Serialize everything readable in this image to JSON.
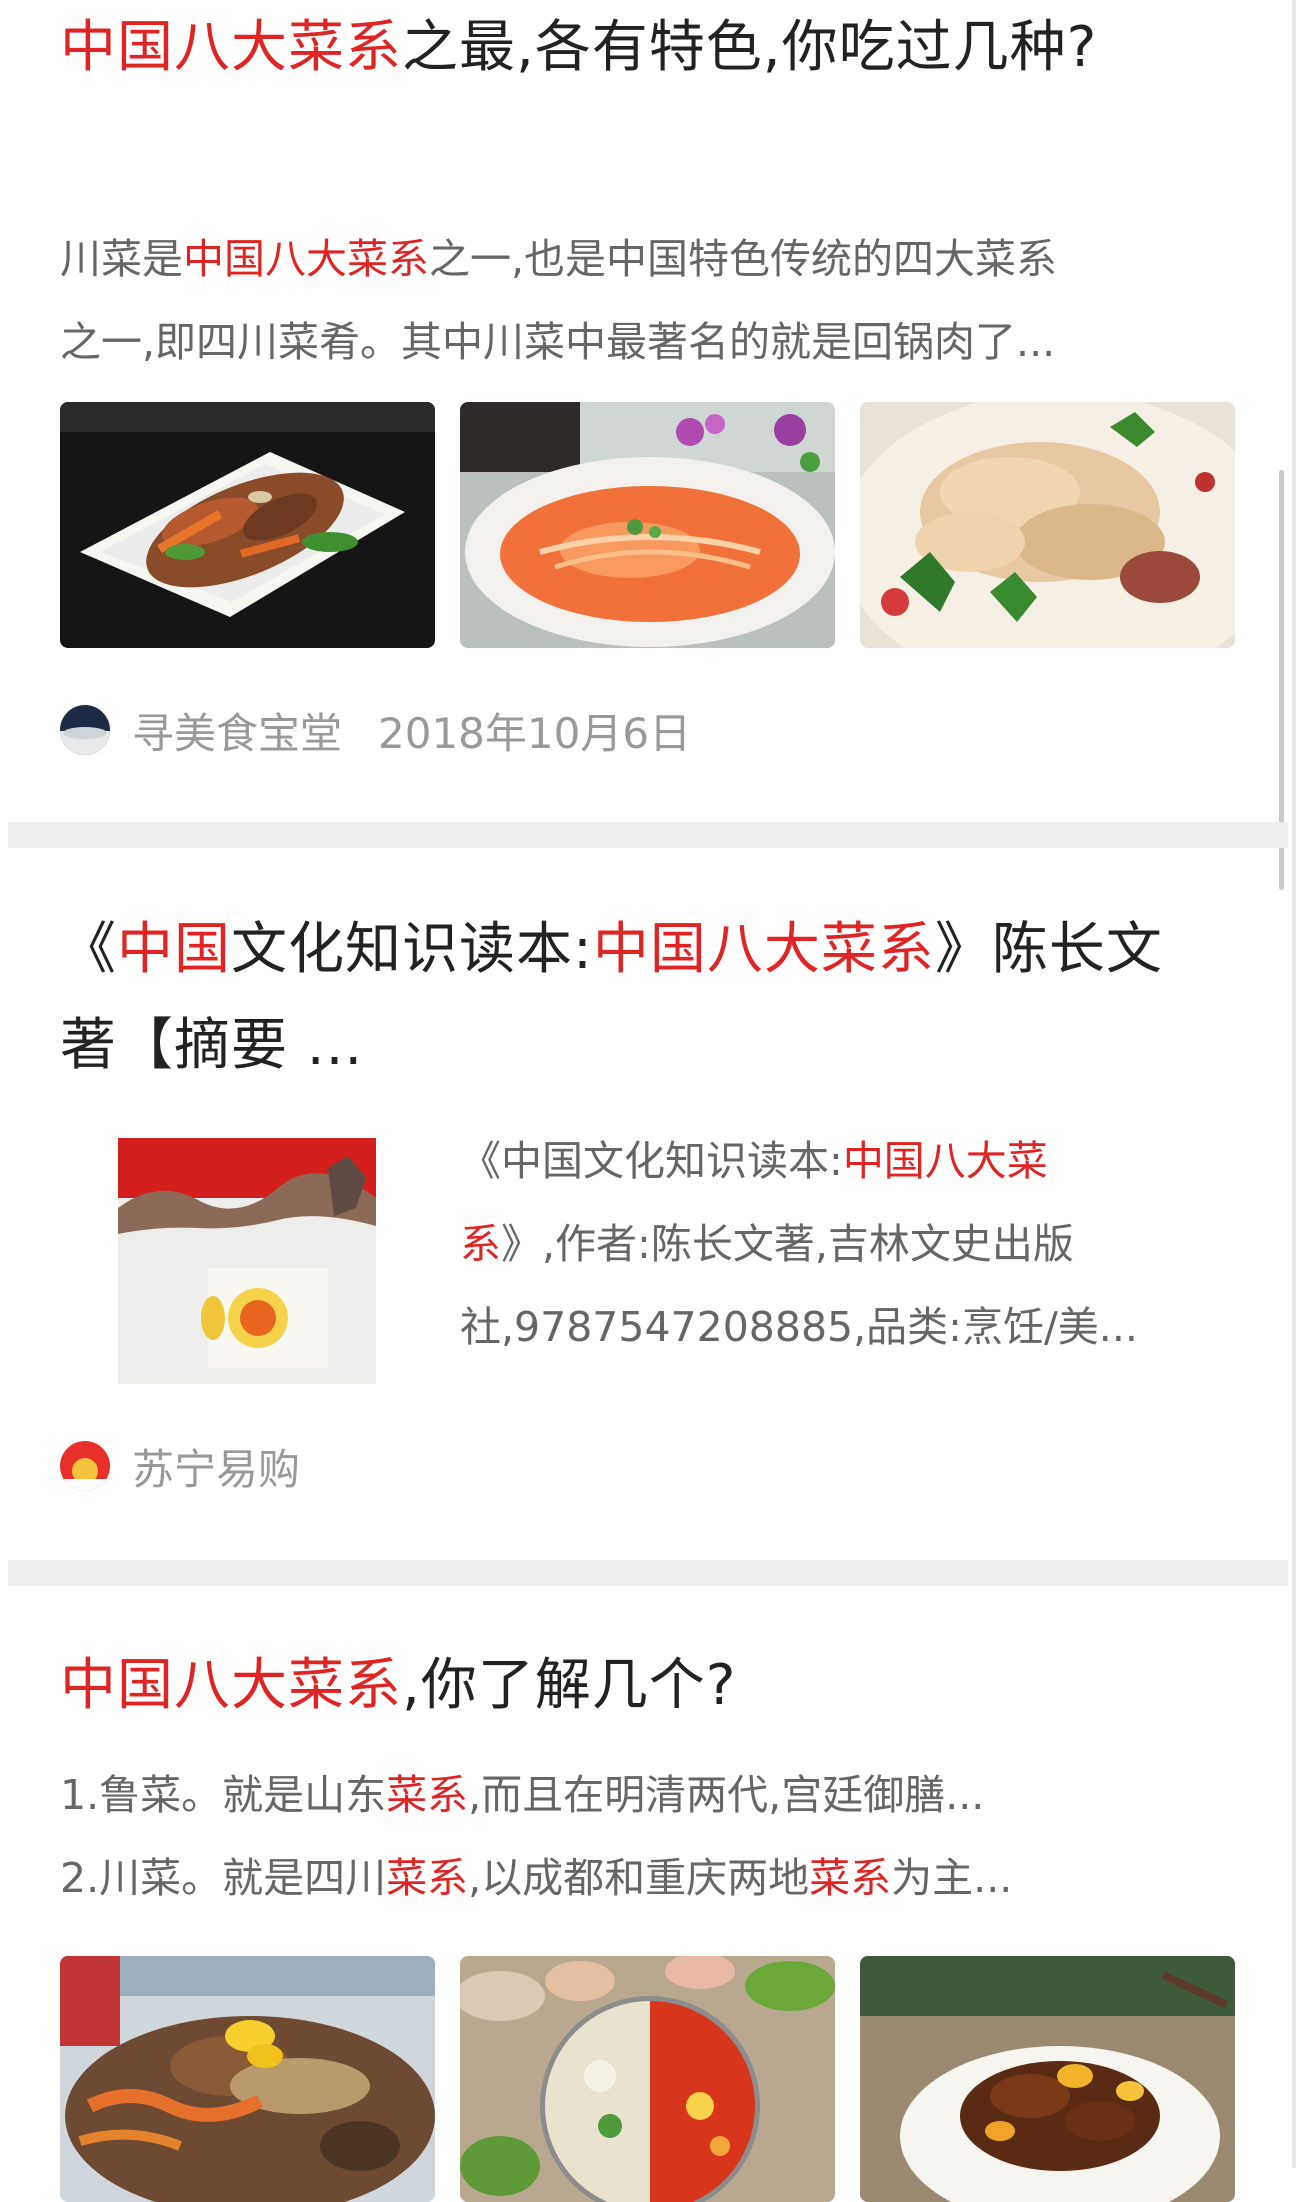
{
  "results": [
    {
      "title": {
        "hl1": "中国八大菜系",
        "rest": "之最,各有特色,你吃过几种?"
      },
      "abstract": {
        "line1_a": "川菜是",
        "line1_hl": "中国八大菜系",
        "line1_b": "之一,也是中国特色传统的四大菜系",
        "line2": "之一,即四川菜肴。其中川菜中最著名的就是回锅肉了..."
      },
      "images": [
        "stir-fried-pork-dish",
        "soup-noodle-bowl",
        "sliced-chicken-dish"
      ],
      "source": "寻美食宝堂",
      "date": "2018年10月6日"
    },
    {
      "title": {
        "a": "《",
        "hl1": "中国",
        "b": "文化知识读本:",
        "hl2": "中国八大菜系",
        "c": "》陈长文著【摘要 ..."
      },
      "abstract": {
        "line1_a": "《中国文化知识读本:",
        "line1_hl": "中国八大菜",
        "line2_hl": "系",
        "line2_b": "》,作者:陈长文著,吉林文史出版",
        "line3": "社,9787547208885,品类:烹饪/美..."
      },
      "images": [
        "book-cover"
      ],
      "source": "苏宁易购"
    },
    {
      "title": {
        "hl1": "中国八大菜系",
        "rest": ",你了解几个?"
      },
      "abstract": {
        "line1_a": "1.鲁菜。就是山东",
        "line1_hl": "菜系",
        "line1_b": ",而且在明清两代,宫廷御膳...",
        "line2_a": "2.川菜。就是四川",
        "line2_hl": "菜系",
        "line2_b": ",以成都和重庆两地",
        "line2_hl2": "菜系",
        "line2_c": "为主..."
      },
      "images": [
        "seafood-platter",
        "hotpot",
        "braised-meat-dish"
      ]
    }
  ],
  "colors": {
    "highlight": "#e02424",
    "title": "#222222",
    "abstract": "#666666",
    "meta": "#999999",
    "divider": "#eeeeee"
  }
}
